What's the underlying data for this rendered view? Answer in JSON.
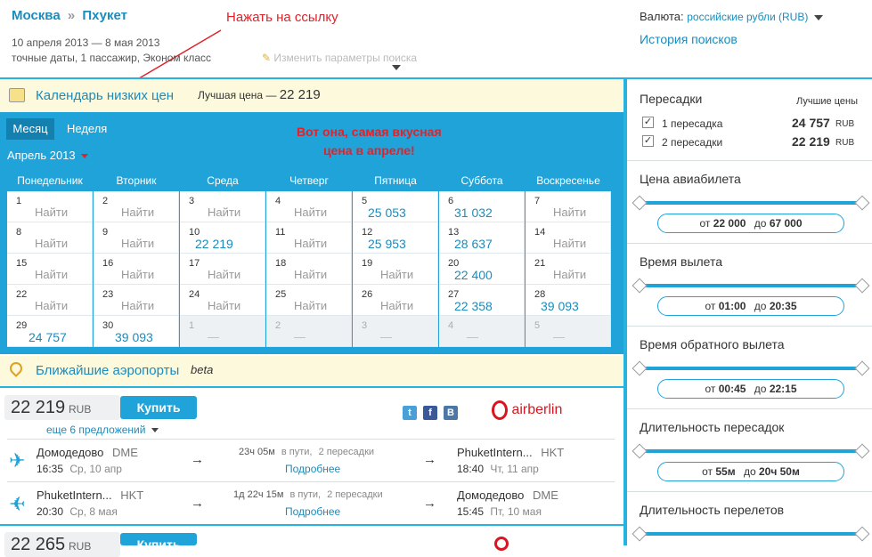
{
  "header": {
    "from": "Москва",
    "sep": "»",
    "to": "Пхукет",
    "annotation": "Нажать на ссылку",
    "dates": "10 апреля 2013 — 8 мая 2013",
    "params": "точные даты, 1 пассажир, Эконом класс",
    "change_params": "Изменить параметры поиска",
    "currency_label": "Валюта:",
    "currency_value": "российские рубли (RUB)",
    "history": "История поисков"
  },
  "calendar": {
    "title": "Календарь низких цен",
    "best_label": "Лучшая цена —",
    "best_value": "22 219",
    "tab_month": "Месяц",
    "tab_week": "Неделя",
    "month": "Апрель 2013",
    "annotation_line1": "Вот она, самая вкусная",
    "annotation_line2": "цена в апреле!",
    "days": [
      "Понедельник",
      "Вторник",
      "Среда",
      "Четверг",
      "Пятница",
      "Суббота",
      "Воскресенье"
    ],
    "cells": [
      {
        "d": "1",
        "v": "Найти"
      },
      {
        "d": "2",
        "v": "Найти"
      },
      {
        "d": "3",
        "v": "Найти"
      },
      {
        "d": "4",
        "v": "Найти"
      },
      {
        "d": "5",
        "v": "25 053",
        "p": true
      },
      {
        "d": "6",
        "v": "31 032",
        "p": true
      },
      {
        "d": "7",
        "v": "Найти"
      },
      {
        "d": "8",
        "v": "Найти"
      },
      {
        "d": "9",
        "v": "Найти"
      },
      {
        "d": "10",
        "v": "22 219",
        "p": true
      },
      {
        "d": "11",
        "v": "Найти"
      },
      {
        "d": "12",
        "v": "25 953",
        "p": true
      },
      {
        "d": "13",
        "v": "28 637",
        "p": true
      },
      {
        "d": "14",
        "v": "Найти"
      },
      {
        "d": "15",
        "v": "Найти"
      },
      {
        "d": "16",
        "v": "Найти"
      },
      {
        "d": "17",
        "v": "Найти"
      },
      {
        "d": "18",
        "v": "Найти"
      },
      {
        "d": "19",
        "v": "Найти"
      },
      {
        "d": "20",
        "v": "22 400",
        "p": true
      },
      {
        "d": "21",
        "v": "Найти"
      },
      {
        "d": "22",
        "v": "Найти"
      },
      {
        "d": "23",
        "v": "Найти"
      },
      {
        "d": "24",
        "v": "Найти"
      },
      {
        "d": "25",
        "v": "Найти"
      },
      {
        "d": "26",
        "v": "Найти"
      },
      {
        "d": "27",
        "v": "22 358",
        "p": true
      },
      {
        "d": "28",
        "v": "39 093",
        "p": true
      },
      {
        "d": "29",
        "v": "24 757",
        "p": true
      },
      {
        "d": "30",
        "v": "39 093",
        "p": true
      },
      {
        "d": "1",
        "v": "—",
        "off": true
      },
      {
        "d": "2",
        "v": "—",
        "off": true
      },
      {
        "d": "3",
        "v": "—",
        "off": true
      },
      {
        "d": "4",
        "v": "—",
        "off": true
      },
      {
        "d": "5",
        "v": "—",
        "off": true
      }
    ]
  },
  "airports": {
    "title": "Ближайшие аэропорты",
    "badge": "beta"
  },
  "offer1": {
    "price": "22 219",
    "currency": "RUB",
    "buy": "Купить",
    "more": "еще 6 предложений",
    "airline": "airberlin",
    "leg1": {
      "from": "Домодедово",
      "from_code": "DME",
      "dep_time": "16:35",
      "dep_date": "Ср, 10 апр",
      "duration": "23ч 05м",
      "in_way": "в пути,",
      "stops": "2 пересадки",
      "details": "Подробнее",
      "to": "PhuketIntern...",
      "to_code": "HKT",
      "arr_time": "18:40",
      "arr_date": "Чт, 11 апр"
    },
    "leg2": {
      "from": "PhuketIntern...",
      "from_code": "HKT",
      "dep_time": "20:30",
      "dep_date": "Ср, 8 мая",
      "duration": "1д 22ч 15м",
      "in_way": "в пути,",
      "stops": "2 пересадки",
      "details": "Подробнее",
      "to": "Домодедово",
      "to_code": "DME",
      "arr_time": "15:45",
      "arr_date": "Пт, 10 мая"
    }
  },
  "offer2": {
    "price": "22 265",
    "currency": "RUB",
    "buy": "Купить"
  },
  "filters": {
    "stops_title": "Пересадки",
    "best_prices": "Лучшие цены",
    "stops": [
      {
        "label": "1 пересадка",
        "price": "24 757",
        "cur": "RUB"
      },
      {
        "label": "2 пересадки",
        "price": "22 219",
        "cur": "RUB"
      }
    ],
    "price_title": "Цена авиабилета",
    "price_from": "от",
    "price_min": "22 000",
    "price_to": "до",
    "price_max": "67 000",
    "dep_title": "Время вылета",
    "dep_from": "от",
    "dep_min": "01:00",
    "dep_to": "до",
    "dep_max": "20:35",
    "ret_title": "Время обратного вылета",
    "ret_from": "от",
    "ret_min": "00:45",
    "ret_to": "до",
    "ret_max": "22:15",
    "layover_title": "Длительность пересадок",
    "lay_from": "от",
    "lay_min": "55м",
    "lay_to": "до",
    "lay_max": "20ч 50м",
    "flight_title": "Длительность перелетов"
  },
  "colors": {
    "accent": "#1fa3d9",
    "annotation": "#e0222a",
    "highlight": "#fdf9dc"
  }
}
